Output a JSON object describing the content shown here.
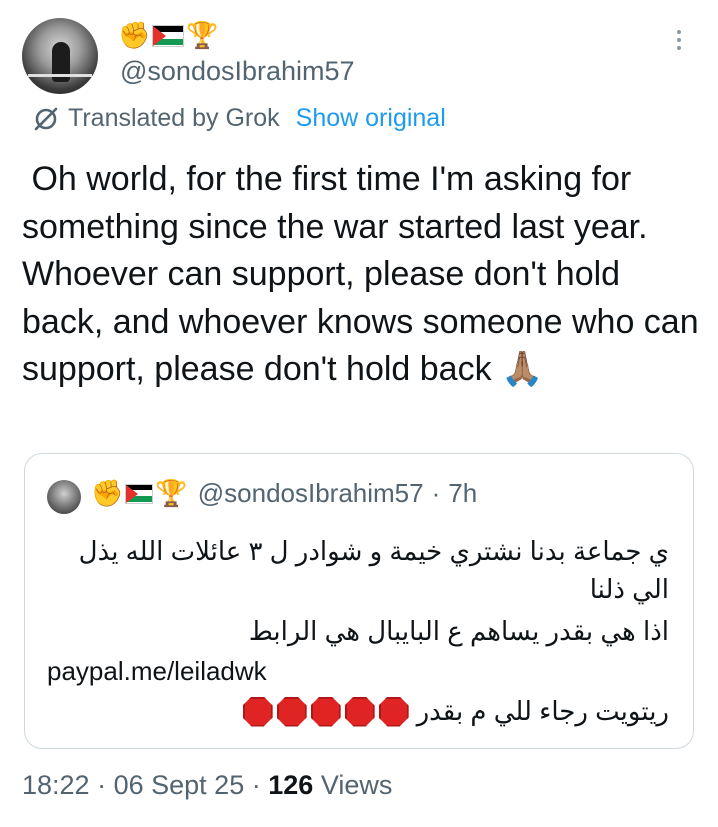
{
  "author": {
    "badge_icons": [
      "raised-fist-icon",
      "palestine-flag-icon",
      "trophy-icon"
    ],
    "handle": "@sondosIbrahim57"
  },
  "translation": {
    "label": "Translated by Grok",
    "show_original_label": "Show original"
  },
  "post": {
    "text": " Oh world, for the first time I'm asking for something since the war started last year. Whoever can support, please don't hold back, and whoever knows someone who can support, please don't hold back 🙏🏽"
  },
  "quoted_post": {
    "handle": "@sondosIbrahim57",
    "separator": "·",
    "time_ago": "7h",
    "lines": [
      "ي جماعة بدنا نشتري خيمة و شوادر ل ٣ عائلات الله يذل",
      "الي ذلنا",
      "اذا هي بقدر يساهم ع البايبال هي الرابط"
    ],
    "link": "paypal.me/leiladwk",
    "last_line": "ريتويت رجاء للي م بقدر",
    "stop_sign_count": 5
  },
  "footer": {
    "time": "18:22",
    "separator": "·",
    "date": "06 Sept 25",
    "views_count": "126",
    "views_label": "Views"
  },
  "colors": {
    "link": "#1d9bf0",
    "secondary_text": "#536471",
    "primary_text": "#0f1419",
    "border": "#cfd9de"
  }
}
